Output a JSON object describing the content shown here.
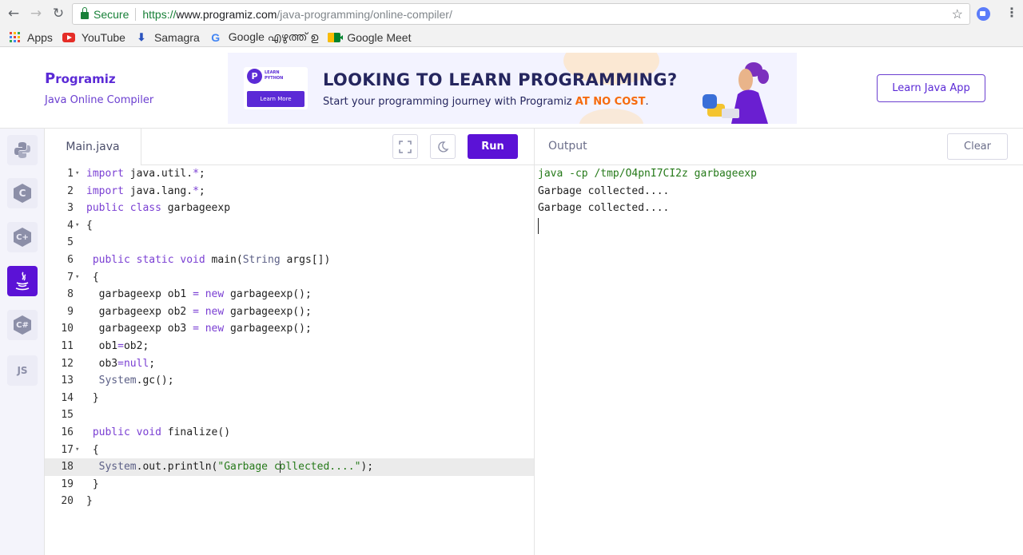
{
  "browser": {
    "secure_label": "Secure",
    "url_scheme": "https://",
    "url_host": "www.programiz.com",
    "url_path": "/java-programming/online-compiler/",
    "bookmarks": [
      {
        "label": "Apps",
        "icon": "apps-grid-icon"
      },
      {
        "label": "YouTube",
        "icon": "youtube-icon"
      },
      {
        "label": "Samagra",
        "icon": "samagra-icon"
      },
      {
        "label": "Google എഴുത്ത് ഉ",
        "icon": "google-icon"
      },
      {
        "label": "Google Meet",
        "icon": "google-meet-icon"
      }
    ]
  },
  "header": {
    "logo": "rogramiz",
    "logo_initial": "P",
    "subtitle": "Java Online Compiler",
    "learn_button": "Learn Java App",
    "banner": {
      "book_logo": "P",
      "book_tag": "LEARN PYTHON",
      "book_button": "Learn More",
      "title": "LOOKING TO LEARN PROGRAMMING?",
      "subtitle_pre": "Start your programming journey with Programiz ",
      "subtitle_highlight": "AT NO COST",
      "subtitle_post": "."
    }
  },
  "rail": {
    "languages": [
      {
        "name": "Python",
        "icon": "python-icon"
      },
      {
        "name": "C",
        "icon": "c-icon"
      },
      {
        "name": "C++",
        "icon": "cpp-icon"
      },
      {
        "name": "Java",
        "icon": "java-icon",
        "active": true
      },
      {
        "name": "C#",
        "icon": "csharp-icon"
      },
      {
        "name": "JavaScript",
        "icon": "js-icon",
        "label": "JS"
      }
    ]
  },
  "editor": {
    "file_tab": "Main.java",
    "run_label": "Run",
    "active_line": 18,
    "lines": [
      {
        "n": "1",
        "fold": true
      },
      {
        "n": "2"
      },
      {
        "n": "3"
      },
      {
        "n": "4",
        "fold": true
      },
      {
        "n": "5"
      },
      {
        "n": "6"
      },
      {
        "n": "7",
        "fold": true
      },
      {
        "n": "8"
      },
      {
        "n": "9"
      },
      {
        "n": "10"
      },
      {
        "n": "11"
      },
      {
        "n": "12"
      },
      {
        "n": "13"
      },
      {
        "n": "14"
      },
      {
        "n": "15"
      },
      {
        "n": "16"
      },
      {
        "n": "17",
        "fold": true
      },
      {
        "n": "18"
      },
      {
        "n": "19"
      },
      {
        "n": "20"
      }
    ],
    "code": {
      "l1_kw": "import",
      "l1_rest": " java.util.",
      "l1_op": "*",
      "l1_end": ";",
      "l2_kw": "import",
      "l2_rest": " java.lang.",
      "l2_op": "*",
      "l2_end": ";",
      "l3_kw": "public class",
      "l3_rest": " garbageexp",
      "l4": "{",
      "l6_kw": "public static void",
      "l6_rest": " main(",
      "l6_ty": "String",
      "l6_end": " args[])",
      "l7": "{",
      "l8_a": "garbageexp ob1 ",
      "l8_op": "=",
      "l8_sp": " ",
      "l8_kw": "new",
      "l8_b": " garbageexp();",
      "l9_a": "garbageexp ob2 ",
      "l9_op": "=",
      "l9_sp": " ",
      "l9_kw": "new",
      "l9_b": " garbageexp();",
      "l10_a": "garbageexp ob3 ",
      "l10_op": "=",
      "l10_sp": " ",
      "l10_kw": "new",
      "l10_b": " garbageexp();",
      "l11_a": "ob1",
      "l11_op": "=",
      "l11_b": "ob2;",
      "l12_a": "ob3",
      "l12_op": "=",
      "l12_kw": "null",
      "l12_b": ";",
      "l13_ty": "System",
      "l13_b": ".gc();",
      "l14": "}",
      "l16_kw": "public void",
      "l16_rest": " finalize()",
      "l17": "{",
      "l18_ty": "System",
      "l18_a": ".out.println(",
      "l18_str1": "\"Garbage c",
      "l18_str2": "ollected....\"",
      "l18_b": ");",
      "l19": "}",
      "l20": "}"
    }
  },
  "output": {
    "title": "Output",
    "clear_label": "Clear",
    "lines": [
      "java -cp /tmp/O4pnI7CI2z garbageexp",
      "Garbage collected....",
      "Garbage collected...."
    ]
  },
  "colors": {
    "brand_purple": "#5b12d6",
    "banner_highlight": "#f66b0e",
    "output_command": "#267a1a"
  }
}
